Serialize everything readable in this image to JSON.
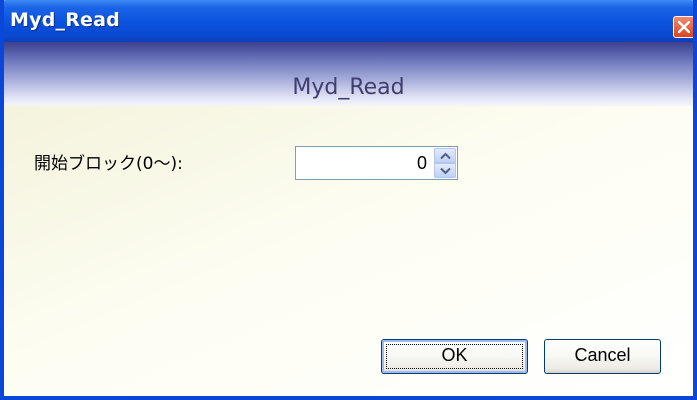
{
  "window": {
    "title": "Myd_Read"
  },
  "titlebar": {
    "close_icon": "close-icon",
    "close_color": "#d9431e"
  },
  "banner": {
    "title": "Myd_Read"
  },
  "form": {
    "start_block_label": "開始ブロック(0〜):",
    "start_block_value": "0"
  },
  "buttons": {
    "ok_label": "OK",
    "cancel_label": "Cancel"
  },
  "colors": {
    "title_blue": "#0a52dd",
    "frame_blue": "#0a46d8"
  }
}
